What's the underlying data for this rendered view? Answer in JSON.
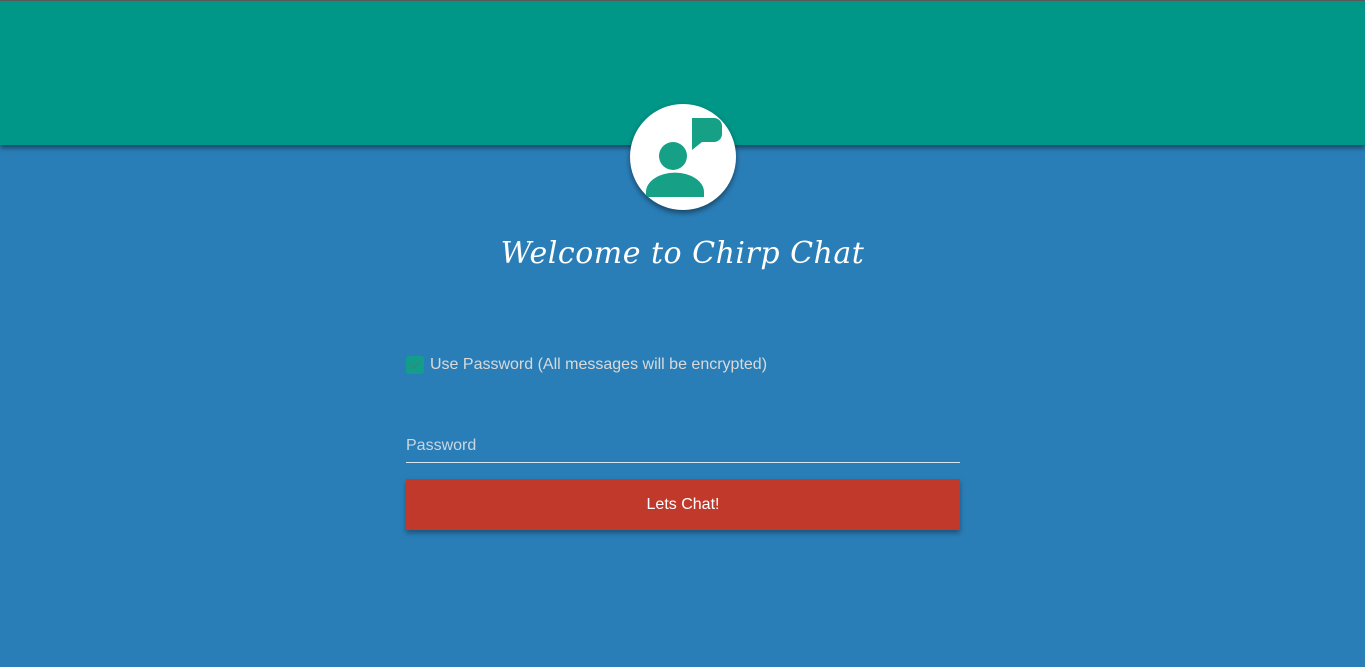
{
  "header": {
    "color": "#009688"
  },
  "avatar": {
    "icon": "user-chat-icon",
    "accent_color": "#16a085"
  },
  "welcome": {
    "title": "Welcome to Chirp Chat"
  },
  "form": {
    "use_password_checked": true,
    "use_password_label": "Use Password (All messages will be encrypted)",
    "password_placeholder": "Password",
    "password_value": "",
    "submit_label": "Lets Chat!",
    "submit_color": "#c0392b"
  }
}
